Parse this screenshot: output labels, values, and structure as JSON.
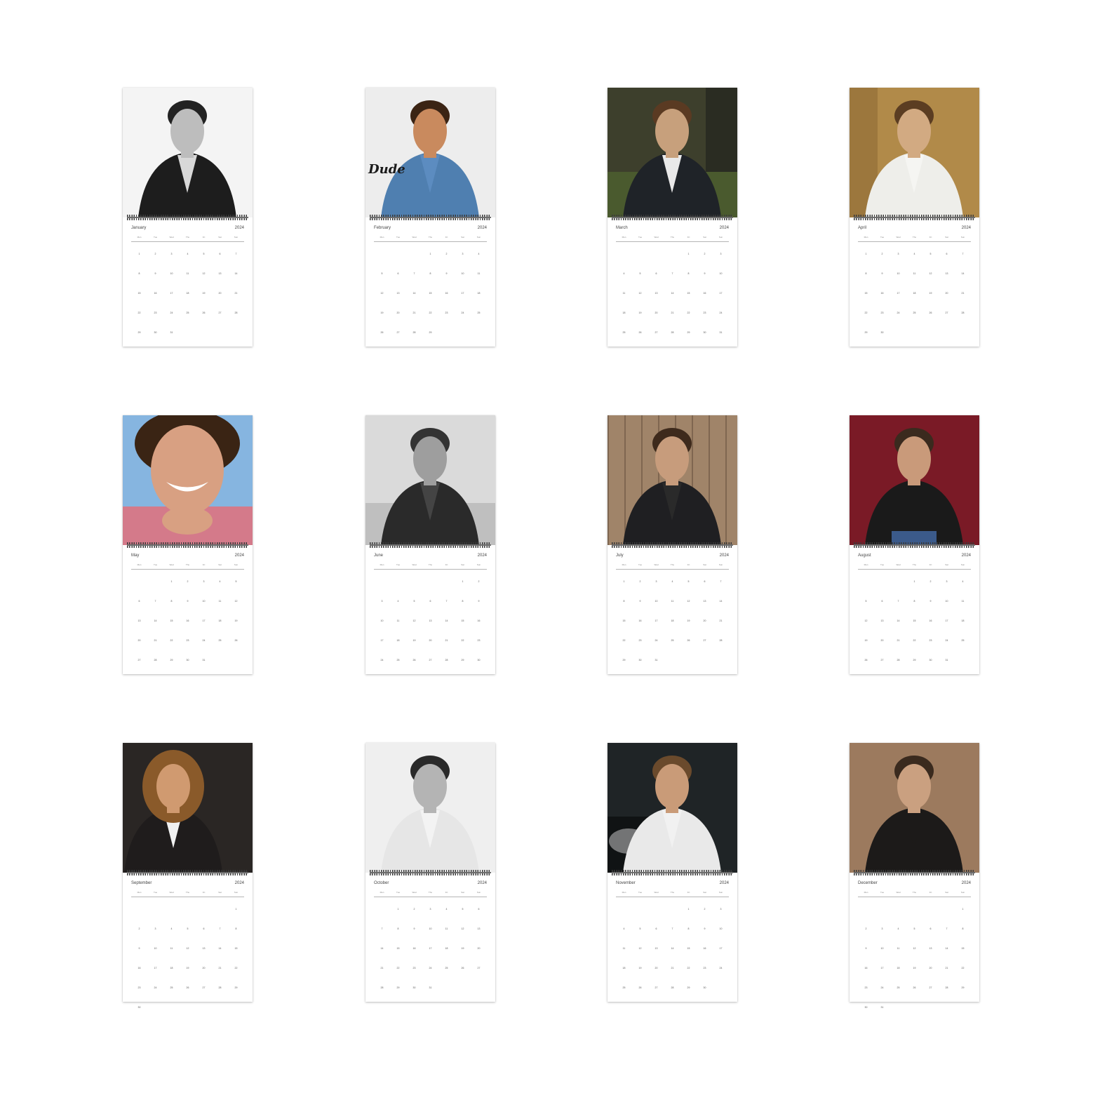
{
  "year": "2024",
  "weekdays": [
    "Mon",
    "Tue",
    "Wed",
    "Thu",
    "Fri",
    "Sat",
    "Sun"
  ],
  "months": [
    {
      "name": "January",
      "photo": "bw-leather-jacket",
      "first": 0,
      "days": 31
    },
    {
      "name": "February",
      "photo": "denim-shirt-dude",
      "photo_text": "Dude",
      "first": 3,
      "days": 29
    },
    {
      "name": "March",
      "photo": "suit-green-sofa",
      "first": 4,
      "days": 31
    },
    {
      "name": "April",
      "photo": "white-shirt-gold-wall",
      "first": 0,
      "days": 30
    },
    {
      "name": "May",
      "photo": "smile-pink-shirt-blue-sky",
      "first": 2,
      "days": 31
    },
    {
      "name": "June",
      "photo": "bw-beach-wave",
      "first": 5,
      "days": 30
    },
    {
      "name": "July",
      "photo": "black-suit-wood-wall",
      "first": 0,
      "days": 31
    },
    {
      "name": "August",
      "photo": "black-tee-red-backdrop",
      "first": 3,
      "days": 31
    },
    {
      "name": "September",
      "photo": "curly-hair-suit-raised-hand",
      "first": 6,
      "days": 30
    },
    {
      "name": "October",
      "photo": "bw-portrait-white-shirt",
      "first": 1,
      "days": 31
    },
    {
      "name": "November",
      "photo": "white-tee-car-night",
      "first": 4,
      "days": 30
    },
    {
      "name": "December",
      "photo": "black-tee-brown-backdrop",
      "first": 6,
      "days": 31
    }
  ],
  "colors": {
    "spiral": "#3a3a3a",
    "card_bg": "#ffffff",
    "page_bg": "#ffffff"
  }
}
